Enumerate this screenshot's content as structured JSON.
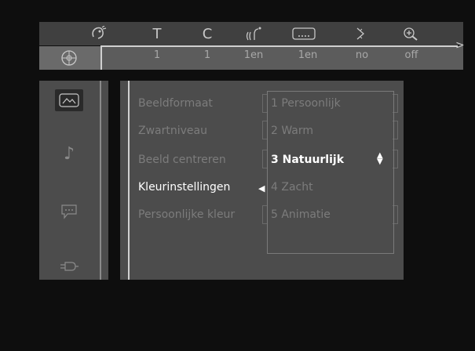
{
  "status_bar": {
    "icons": [
      "angle-icon",
      "subtitle-icon",
      "chapter-icon",
      "audio-icon",
      "title-menu-icon",
      "arrow-icon",
      "zoom-icon"
    ],
    "icon_glyphs": {
      "subtitle": "T",
      "chapter": "C"
    },
    "values": [
      "1",
      "1",
      "1en",
      "1en",
      "no",
      "off"
    ]
  },
  "sidebar": {
    "items": [
      "picture-icon",
      "music-note-icon",
      "message-icon",
      "plug-icon"
    ],
    "note_glyph": "♪"
  },
  "menu": {
    "items": [
      {
        "label": "Beeldformaat"
      },
      {
        "label": "Zwartniveau"
      },
      {
        "label": "Beeld centreren"
      },
      {
        "label": "Kleurinstellingen"
      },
      {
        "label": "Persoonlijke kleur"
      }
    ],
    "active_index": 3
  },
  "submenu": {
    "options": [
      {
        "label": "1 Persoonlijk"
      },
      {
        "label": "2 Warm"
      },
      {
        "label": "3 Natuurlijk"
      },
      {
        "label": "4 Zacht"
      },
      {
        "label": "5 Animatie"
      }
    ],
    "selected_index": 2,
    "selection_arrow": "◀",
    "updown_glyph": "▲▼"
  }
}
